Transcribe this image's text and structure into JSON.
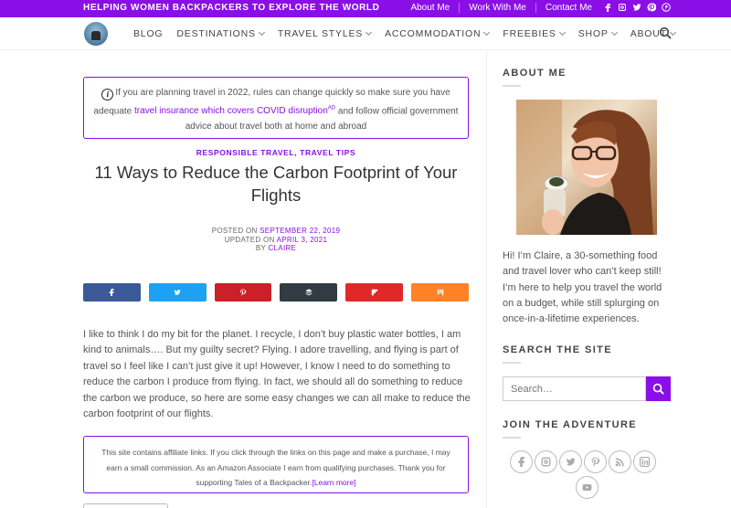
{
  "topbar": {
    "tagline": "HELPING WOMEN BACKPACKERS TO EXPLORE THE WORLD",
    "links": [
      "About Me",
      "Work With Me",
      "Contact Me"
    ],
    "icons": [
      "facebook-icon",
      "instagram-icon",
      "twitter-icon",
      "pinterest-icon",
      "pinterest-alt-icon"
    ]
  },
  "nav": {
    "items": [
      {
        "label": "BLOG",
        "dropdown": false
      },
      {
        "label": "DESTINATIONS",
        "dropdown": true
      },
      {
        "label": "TRAVEL STYLES",
        "dropdown": true
      },
      {
        "label": "ACCOMMODATION",
        "dropdown": true
      },
      {
        "label": "FREEBIES",
        "dropdown": true
      },
      {
        "label": "SHOP",
        "dropdown": true
      },
      {
        "label": "ABOUT",
        "dropdown": true
      }
    ]
  },
  "notice": {
    "text_before": "If you are planning travel in 2022, rules can change quickly so make sure you have adequate",
    "link": "travel insurance which covers COVID disruption",
    "link_sup": "AD",
    "text_after": "and follow official government advice about travel both at home and abroad"
  },
  "post": {
    "categories": "RESPONSIBLE TRAVEL, TRAVEL TIPS",
    "title": "11 Ways to Reduce the Carbon Footprint of Your Flights",
    "posted_on_label": "POSTED ON",
    "posted_date": "SEPTEMBER 22, 2019",
    "updated_label": "UPDATED ON",
    "updated_date": "APRIL 3, 2021",
    "by_label": "BY",
    "author": "CLAIRE",
    "body": "I like to think I do my bit for the planet.  I recycle, I don’t buy plastic water bottles, I am kind to animals…. But my guilty secret?  Flying.  I adore travelling, and flying is part of travel so I feel like I can’t just give it up!  However, I know I need to do something to reduce the carbon I produce from flying.  In fact, we should all do something to reduce the carbon we produce, so here are some easy changes we can all make to reduce the carbon footprint of our flights."
  },
  "share": [
    {
      "icon": "facebook-icon",
      "color": "#3b5998"
    },
    {
      "icon": "twitter-icon",
      "color": "#1da1f2"
    },
    {
      "icon": "pinterest-icon",
      "color": "#cb2027"
    },
    {
      "icon": "buffer-icon",
      "color": "#323b43"
    },
    {
      "icon": "flipboard-icon",
      "color": "#e12828"
    },
    {
      "icon": "mix-icon",
      "color": "#ff8226"
    }
  ],
  "affiliate": {
    "text": "This site contains affiliate links. If you click through the links on this page and make a purchase, I may earn a small commission. As an Amazon Associate I earn from qualifying purchases. Thank you for supporting Tales of a Backpacker.",
    "link": "[Learn more]"
  },
  "sidebar": {
    "about_heading": "ABOUT ME",
    "about_text": "Hi! I’m Claire, a 30-something food and travel lover who can’t keep still! I’m here to help you travel the world on a budget, while still splurging on once-in-a-lifetime experiences.",
    "search_heading": "SEARCH THE SITE",
    "search_placeholder": "Search…",
    "join_heading": "JOIN THE ADVENTURE",
    "social_icons": [
      "facebook-icon",
      "instagram-icon",
      "twitter-icon",
      "pinterest-icon",
      "rss-icon",
      "linkedin-icon",
      "youtube-icon"
    ]
  },
  "colors": {
    "accent": "#8a0fe6"
  }
}
